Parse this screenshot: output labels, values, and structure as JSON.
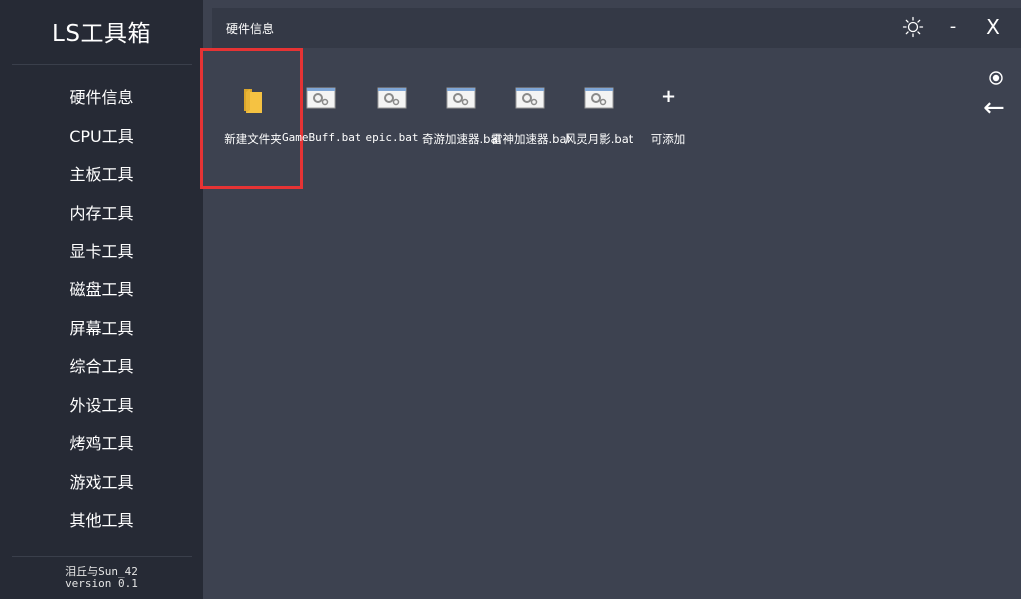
{
  "app": {
    "title": "LS工具箱",
    "author": "泪丘与Sun_42",
    "version": "version 0.1"
  },
  "sidebar": {
    "items": [
      {
        "label": "硬件信息"
      },
      {
        "label": "CPU工具"
      },
      {
        "label": "主板工具"
      },
      {
        "label": "内存工具"
      },
      {
        "label": "显卡工具"
      },
      {
        "label": "磁盘工具"
      },
      {
        "label": "屏幕工具"
      },
      {
        "label": "综合工具"
      },
      {
        "label": "外设工具"
      },
      {
        "label": "烤鸡工具"
      },
      {
        "label": "游戏工具"
      },
      {
        "label": "其他工具"
      }
    ]
  },
  "header": {
    "title": "硬件信息",
    "settings_icon": "sun-gear-icon",
    "minimize_label": "-",
    "close_label": "X"
  },
  "controls": {
    "radio_icon": "radio-icon",
    "back_label": "←"
  },
  "files": [
    {
      "label": "新建文件夹",
      "icon": "folder-icon"
    },
    {
      "label": "GameBuff.bat",
      "icon": "bat-file-icon"
    },
    {
      "label": "epic.bat",
      "icon": "bat-file-icon"
    },
    {
      "label": "奇游加速器.bat",
      "icon": "bat-file-icon"
    },
    {
      "label": "雷神加速器.bat",
      "icon": "bat-file-icon"
    },
    {
      "label": "风灵月影.bat",
      "icon": "bat-file-icon"
    }
  ],
  "add_tile": {
    "label": "可添加",
    "icon": "plus-icon"
  },
  "colors": {
    "sidebar_bg": "#262a35",
    "main_bg": "#3d4250",
    "topbar_bg": "#343946",
    "selection_border": "#e63334",
    "folder_yellow": "#f5c242"
  }
}
